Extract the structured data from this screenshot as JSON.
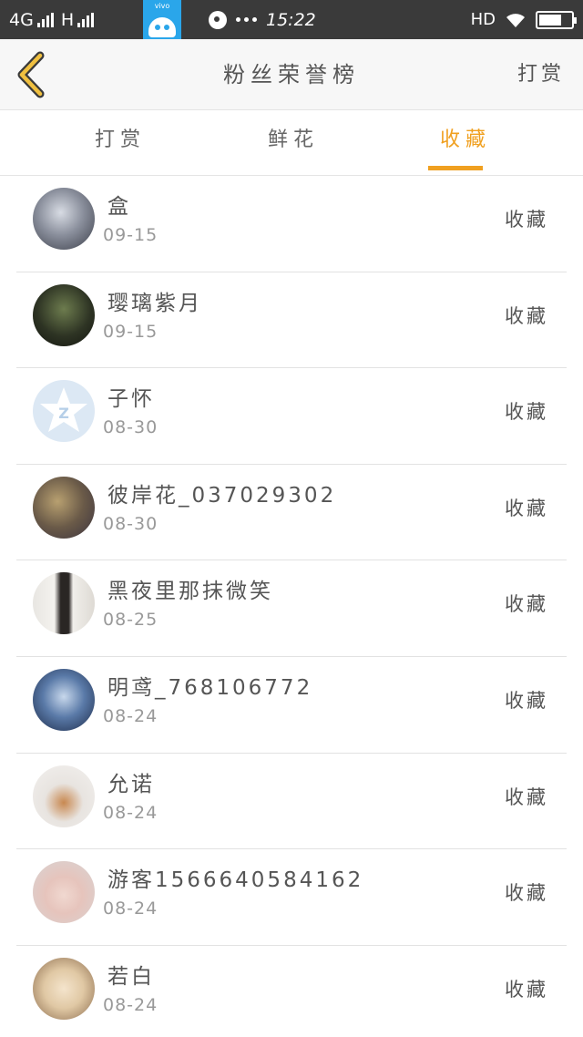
{
  "status_bar": {
    "network": "4G",
    "network2": "H",
    "app_label": "vivo",
    "time": "15:22",
    "hd": "HD"
  },
  "header": {
    "title": "粉丝荣誉榜",
    "action": "打赏"
  },
  "tabs": [
    {
      "label": "打赏",
      "active": false
    },
    {
      "label": "鲜花",
      "active": false
    },
    {
      "label": "收藏",
      "active": true
    }
  ],
  "colors": {
    "accent": "#f0a020",
    "status_bar": "#3a3a3a"
  },
  "fans": [
    {
      "name": "盒",
      "date": "09-15",
      "action": "收藏"
    },
    {
      "name": "璎璃紫月",
      "date": "09-15",
      "action": "收藏"
    },
    {
      "name": "子怀",
      "date": "08-30",
      "action": "收藏"
    },
    {
      "name": "彼岸花_037029302",
      "date": "08-30",
      "action": "收藏"
    },
    {
      "name": "黑夜里那抹微笑",
      "date": "08-25",
      "action": "收藏"
    },
    {
      "name": "明鸢_768106772",
      "date": "08-24",
      "action": "收藏"
    },
    {
      "name": "允诺",
      "date": "08-24",
      "action": "收藏"
    },
    {
      "name": "游客1566640584162",
      "date": "08-24",
      "action": "收藏"
    },
    {
      "name": "若白",
      "date": "08-24",
      "action": "收藏"
    }
  ]
}
